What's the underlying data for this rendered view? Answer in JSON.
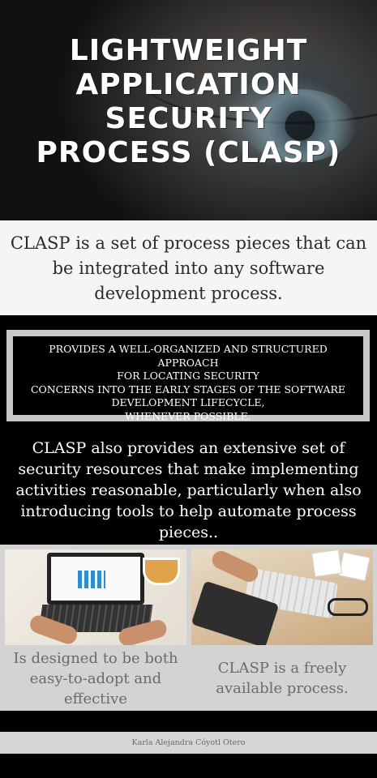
{
  "hero": {
    "title_lines": [
      "LIGHTWEIGHT",
      "APPLICATION",
      "SECURITY",
      "PROCESS (CLASP)"
    ]
  },
  "intro": {
    "text": "CLASP is a set of process pieces that can be integrated into any software development process."
  },
  "highlight_box": {
    "lines": [
      "PROVIDES A WELL-ORGANIZED AND STRUCTURED APPROACH",
      "FOR LOCATING SECURITY",
      "CONCERNS INTO THE EARLY STAGES OF THE SOFTWARE",
      "DEVELOPMENT LIFECYCLE,",
      "WHENEVER POSSIBLE."
    ]
  },
  "resources": {
    "text": "CLASP also provides an extensive set of security resources that make implementing activities reasonable, particularly when also introducing tools to help automate process pieces.."
  },
  "features": {
    "left_caption": "Is designed to be both easy-to-adopt and effective",
    "right_caption": "CLASP is a freely available process."
  },
  "footer": {
    "author": "Karla Alejandra Cóyotl Otero"
  }
}
